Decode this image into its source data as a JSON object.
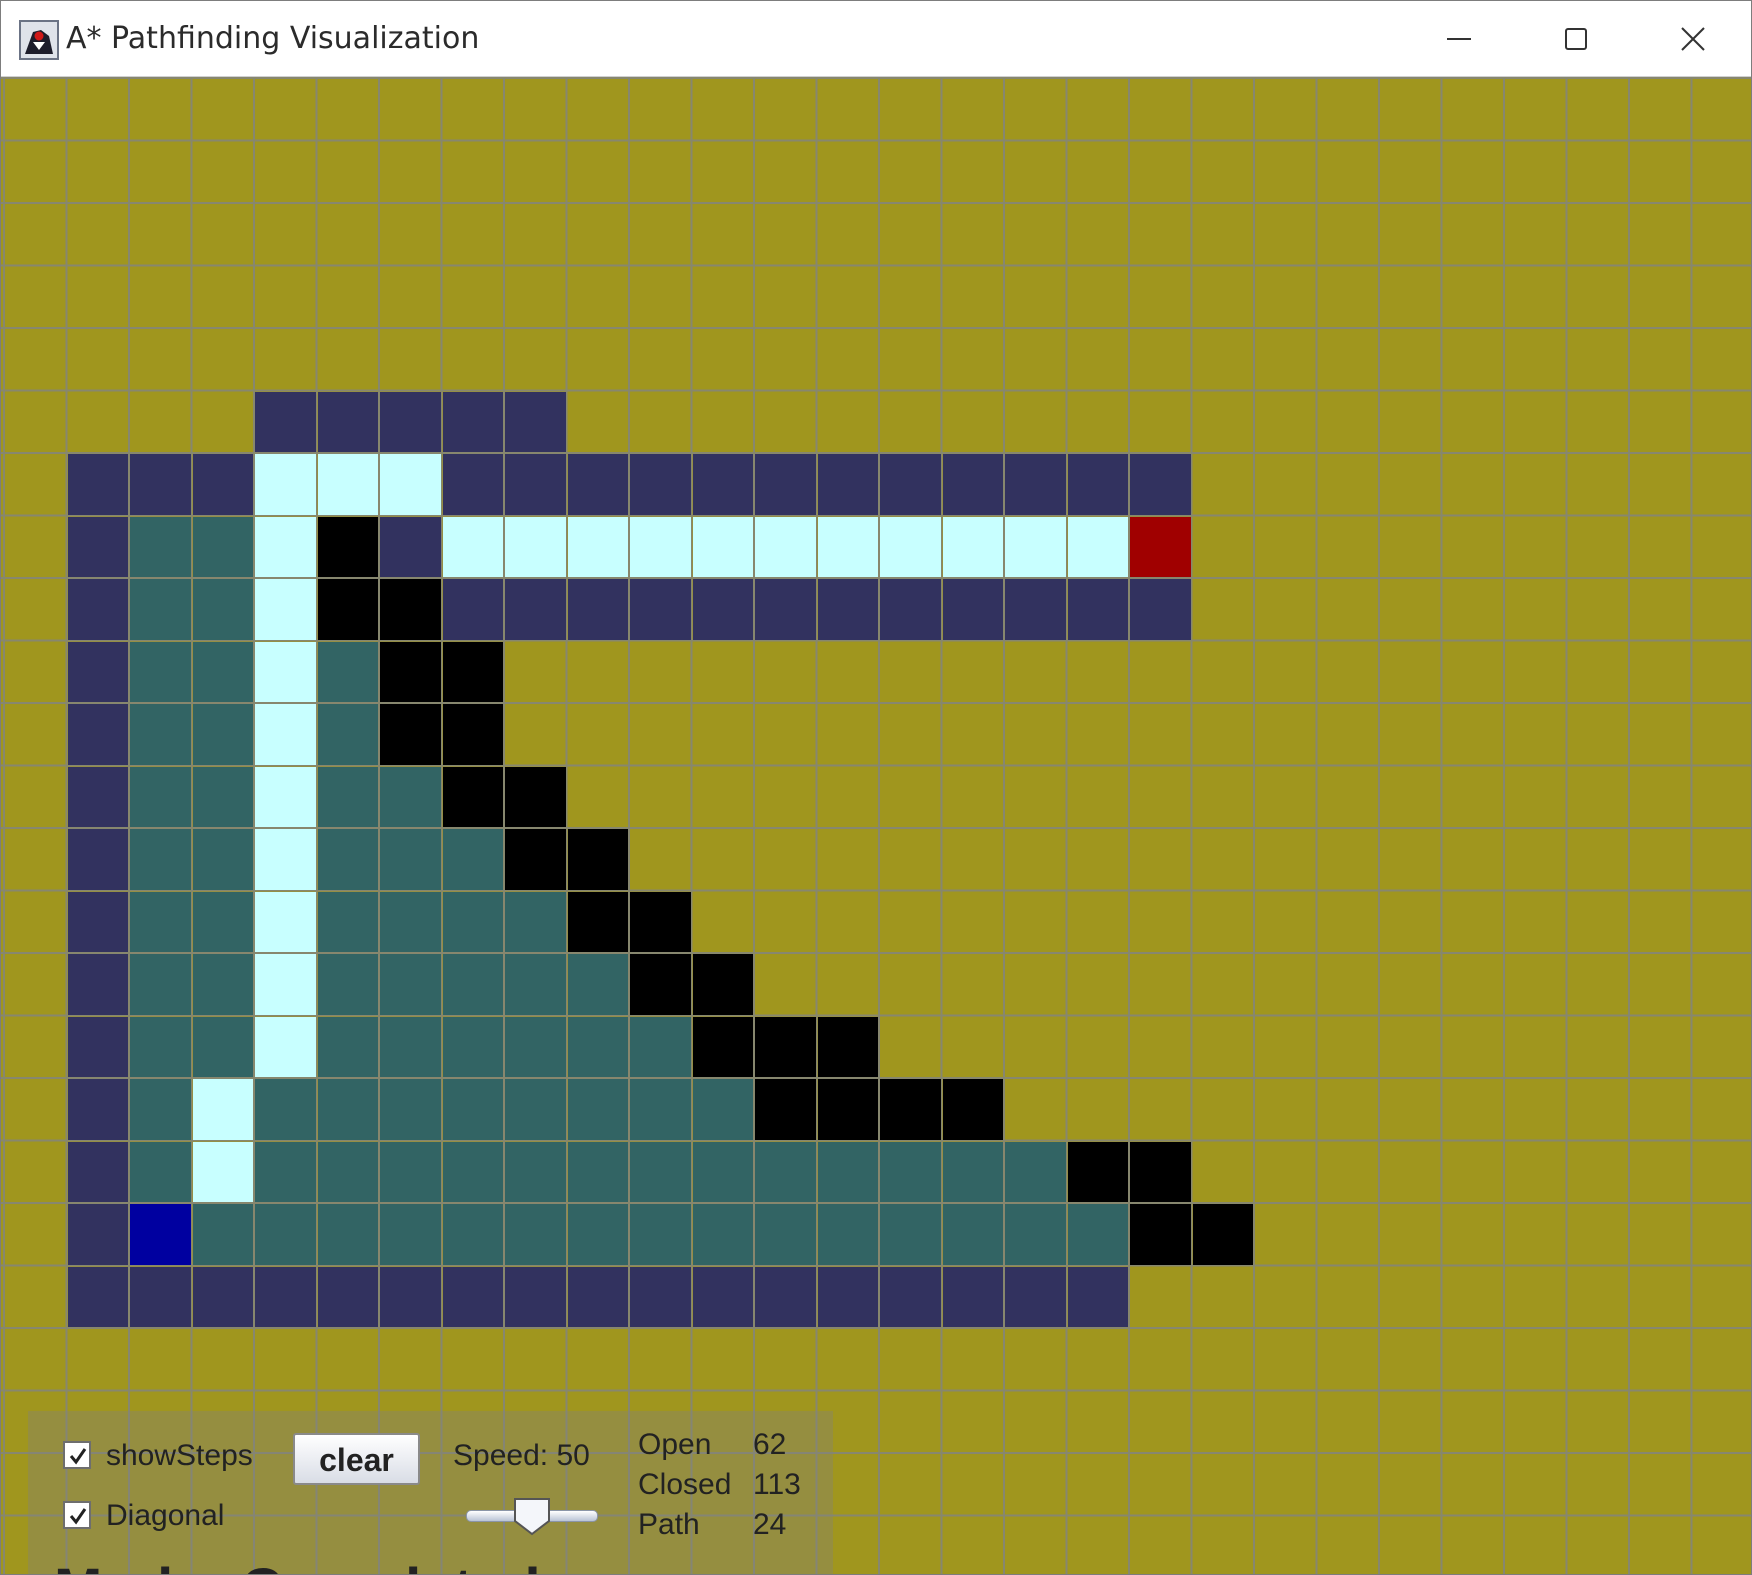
{
  "window": {
    "title": "A* Pathfinding Visualization"
  },
  "grid": {
    "colors": {
      "empty": "#a0961e",
      "gridline": "#87876e",
      "open": "#32325f",
      "closed": "#326464",
      "wall": "#000000",
      "path": "#c8ffff",
      "start": "#0000a0",
      "end": "#a00000"
    },
    "rows": [
      "............................",
      "............................",
      "............................",
      "............................",
      "............................",
      "....OOOOO...................",
      ".OOOPPPOOOOOOOOOOOO.........",
      ".OCCPWOPPPPPPPPPPPE.........",
      ".OCCPWWOOOOOOOOOOOO.........",
      ".OCCPCWW....................",
      ".OCCPCWW....................",
      ".OCCPCCWW...................",
      ".OCCPCCCWW..................",
      ".OCCPCCCCWW.................",
      ".OCCPCCCCCWW................",
      ".OCCPCCCCCCWWW..............",
      ".OCPCCCCCCCCWWWW............",
      ".OCPCCCCCCCCCCCCCWW.........",
      ".OSCCCCCCCCCCCCCCCWW........",
      ".OOOOOOOOOOOOOOOOO..........",
      "............................",
      "............................",
      "............................",
      "............................"
    ]
  },
  "controls": {
    "show_steps": {
      "label": "showSteps",
      "checked": true
    },
    "diagonal": {
      "label": "Diagonal",
      "checked": true
    },
    "clear_label": "clear",
    "speed_label": "Speed:",
    "speed_value": "50",
    "speed_fraction": 0.5
  },
  "stats": {
    "open_label": "Open",
    "open_value": "62",
    "closed_label": "Closed",
    "closed_value": "113",
    "path_label": "Path",
    "path_value": "24"
  },
  "mode_text": "Mode: Completed"
}
